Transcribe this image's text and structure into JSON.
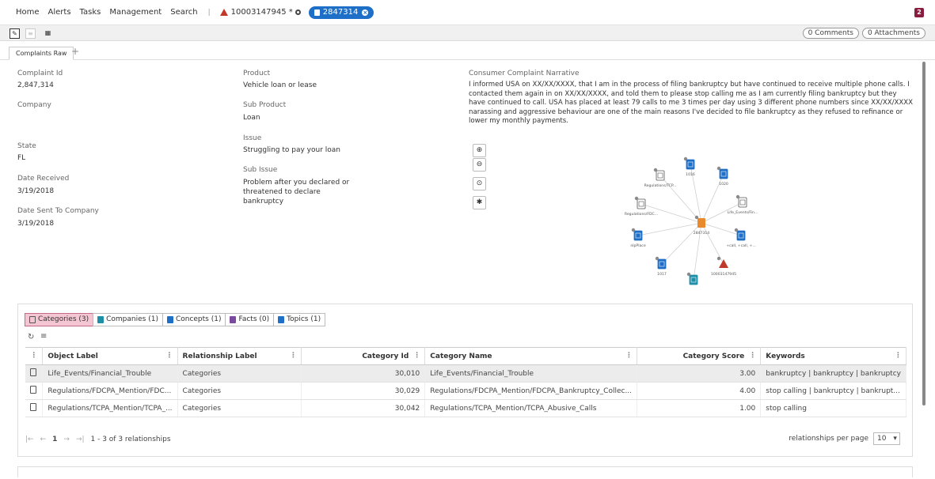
{
  "topnav": {
    "items": [
      "Home",
      "Alerts",
      "Tasks",
      "Management",
      "Search"
    ],
    "separator": "|",
    "ticket_label": "10003147945 *",
    "doc_pill_label": "2847314",
    "user_badge": "2"
  },
  "toolbar": {
    "comments": "0 Comments",
    "attachments": "0 Attachments"
  },
  "tabs": {
    "active": "Complaints Raw",
    "add": "+"
  },
  "fields": {
    "complaint_id_label": "Complaint Id",
    "complaint_id": "2,847,314",
    "company_label": "Company",
    "state_label": "State",
    "state": "FL",
    "date_received_label": "Date Received",
    "date_received": "3/19/2018",
    "date_sent_label": "Date Sent To Company",
    "date_sent": "3/19/2018",
    "product_label": "Product",
    "product": "Vehicle loan or lease",
    "sub_product_label": "Sub Product",
    "sub_product": "Loan",
    "issue_label": "Issue",
    "issue": "Struggling to pay your loan",
    "sub_issue_label": "Sub Issue",
    "sub_issue": "Problem after you declared or threatened to declare bankruptcy",
    "narrative_label": "Consumer Complaint Narrative",
    "narrative": "I informed                                   USA on XX/XX/XXXX, that I am in the process of filing bankruptcy but have continued to receive multiple phone calls. I contacted them again in on XX/XX/XXXX, and told them to please stop calling me as I am currently filing bankruptcy but they have continued to call.                          USA has placed at least 79 calls to me 3 times per day using 3 different phone numbers since XX/XX/XXXX                         narassing and aggressive behaviour are one of the main reasons I've decided to file bankruptcy as they refused to refinance or lower my monthly payments."
  },
  "graph": {
    "center_label": "2847314",
    "nodes": [
      {
        "label": "1016",
        "icon": "list-icon",
        "color": "#1e6fc7"
      },
      {
        "label": "1020",
        "icon": "list-icon",
        "color": "#1e6fc7"
      },
      {
        "label": "Life_Events/Fin...",
        "icon": "document-icon",
        "color": "#555555"
      },
      {
        "label": "+call, +call, +...",
        "icon": "topic-icon",
        "color": "#1e6fc7"
      },
      {
        "label": "10003147945",
        "icon": "warning-icon",
        "color": "#c0392b"
      },
      {
        "label": "",
        "icon": "company-icon",
        "color": "#1e8fa8"
      },
      {
        "label": "1017",
        "icon": "list-icon",
        "color": "#1e6fc7"
      },
      {
        "label": "nlpPlace",
        "icon": "concept-icon",
        "color": "#1e6fc7"
      },
      {
        "label": "Regulations/FDC...",
        "icon": "document-icon",
        "color": "#555555"
      },
      {
        "label": "Regulations/TCP...",
        "icon": "document-icon",
        "color": "#555555"
      }
    ]
  },
  "panel": {
    "tabs": [
      {
        "label": "Categories (3)",
        "icon": "category-icon",
        "color": "#555555"
      },
      {
        "label": "Companies (1)",
        "icon": "company-icon",
        "color": "#1e8fa8"
      },
      {
        "label": "Concepts (1)",
        "icon": "concept-icon",
        "color": "#1e6fc7"
      },
      {
        "label": "Facts (0)",
        "icon": "fact-icon",
        "color": "#7a4aa0"
      },
      {
        "label": "Topics (1)",
        "icon": "topic-icon",
        "color": "#1e6fc7"
      }
    ],
    "columns": [
      "Object Label",
      "Relationship Label",
      "Category Id",
      "Category Name",
      "Category Score",
      "Keywords"
    ],
    "rows": [
      [
        "Life_Events/Financial_Trouble",
        "Categories",
        "30,010",
        "Life_Events/Financial_Trouble",
        "3.00",
        "bankruptcy | bankruptcy | bankruptcy"
      ],
      [
        "Regulations/FDCPA_Mention/FDC...",
        "Categories",
        "30,029",
        "Regulations/FDCPA_Mention/FDCPA_Bankruptcy_Collec...",
        "4.00",
        "stop calling | bankruptcy | bankrupt..."
      ],
      [
        "Regulations/TCPA_Mention/TCPA_...",
        "Categories",
        "30,042",
        "Regulations/TCPA_Mention/TCPA_Abusive_Calls",
        "1.00",
        "stop calling"
      ]
    ],
    "pager": {
      "page": "1",
      "summary": "1 - 3 of 3 relationships",
      "per_page_label": "relationships per page",
      "per_page": "10"
    }
  }
}
